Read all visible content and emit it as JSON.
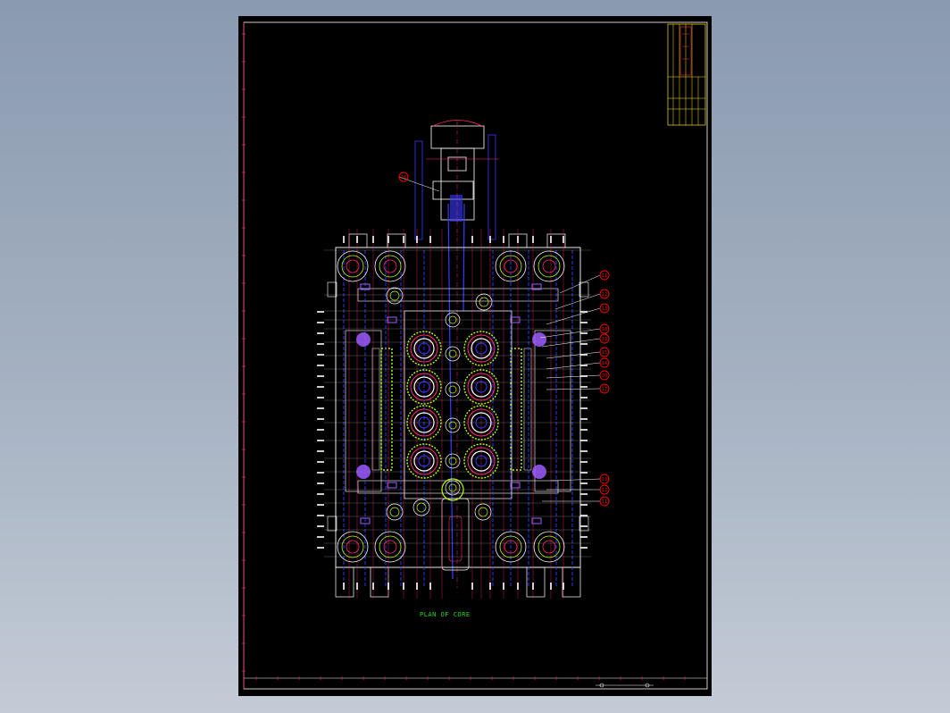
{
  "drawing": {
    "caption": "PLAN OF CORE"
  },
  "colors": {
    "background": "#000000",
    "outline": "#ffffff",
    "dimension": "#ff2a6d",
    "hidden": "#3a3aff",
    "part_green": "#b6ff00",
    "callout": "#ff0000",
    "title_block": "#ffe600",
    "caption": "#22dd22"
  },
  "callouts": [
    "16",
    "11",
    "12",
    "13",
    "18",
    "19",
    "15",
    "14",
    "20",
    "17",
    "13",
    "12",
    "11"
  ]
}
